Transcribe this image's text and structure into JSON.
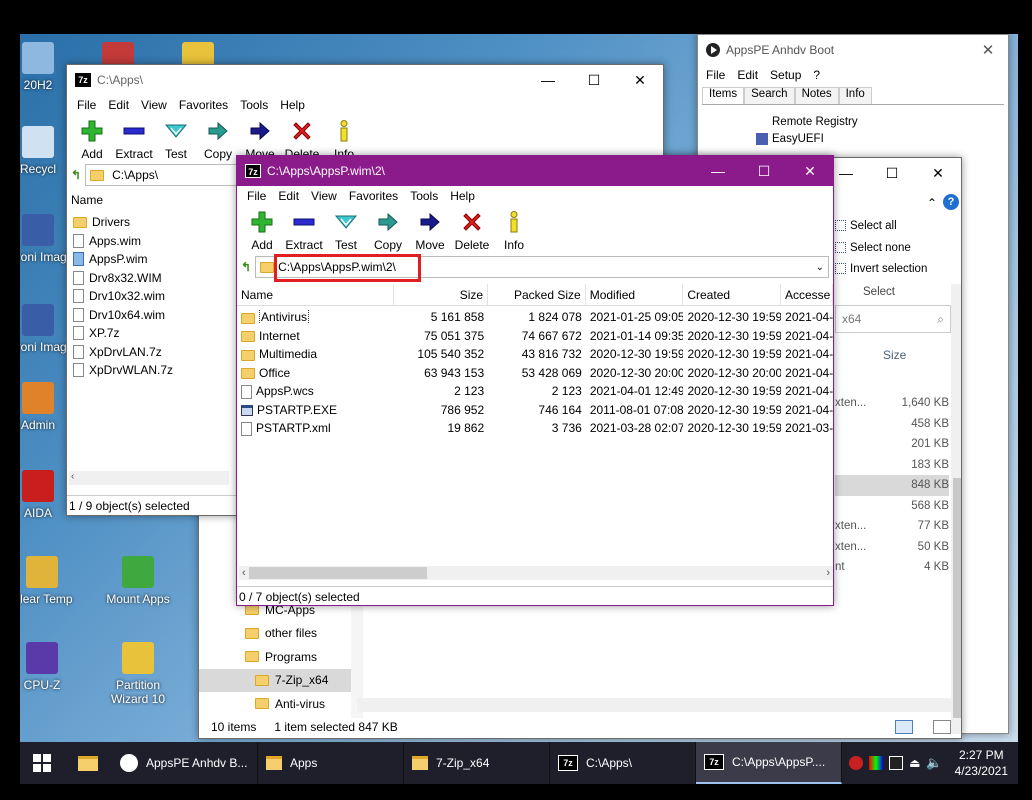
{
  "desktop": {
    "icons": [
      {
        "label": "20H2",
        "icon": "computer-icon",
        "color": "#8fb8e0"
      },
      {
        "label": "",
        "icon": "drive-icon",
        "color": "#c23a3a"
      },
      {
        "label": "",
        "icon": "wizard-icon",
        "color": "#e8c23a"
      },
      {
        "label": "Recycl",
        "icon": "recycle-bin-icon",
        "color": "#d0e2f2"
      },
      {
        "label": "Acroni Image",
        "icon": "acronis-icon",
        "color": "#3a5da8"
      },
      {
        "label": "Acroni Image",
        "icon": "acronis-icon",
        "color": "#3a5da8"
      },
      {
        "label": "Admin",
        "icon": "admin-icon",
        "color": "#e0822a"
      },
      {
        "label": "AIDA",
        "icon": "aida-icon",
        "color": "#c81e1e"
      },
      {
        "label": "Clear Temp",
        "icon": "broom-icon",
        "color": "#e0b43a"
      },
      {
        "label": "Mount Apps",
        "icon": "mount-icon",
        "color": "#3fa83f"
      },
      {
        "label": "CPU-Z",
        "icon": "cpuz-icon",
        "color": "#5a3aa8"
      },
      {
        "label": "Partition Wizard 10",
        "icon": "wizard-icon",
        "color": "#e8c23a"
      }
    ]
  },
  "back_window": {
    "title": "C:\\Apps\\",
    "menu": [
      "File",
      "Edit",
      "View",
      "Favorites",
      "Tools",
      "Help"
    ],
    "toolbar": [
      "Add",
      "Extract",
      "Test",
      "Copy",
      "Move",
      "Delete",
      "Info"
    ],
    "address": "C:\\Apps\\",
    "column_name": "Name",
    "files": [
      {
        "name": "Drivers",
        "type": "folder"
      },
      {
        "name": "Apps.wim",
        "type": "file"
      },
      {
        "name": "AppsP.wim",
        "type": "file-selected"
      },
      {
        "name": "Drv8x32.WIM",
        "type": "file"
      },
      {
        "name": "Drv10x32.wim",
        "type": "file"
      },
      {
        "name": "Drv10x64.wim",
        "type": "file"
      },
      {
        "name": "XP.7z",
        "type": "file"
      },
      {
        "name": "XpDrvLAN.7z",
        "type": "file"
      },
      {
        "name": "XpDrvWLAN.7z",
        "type": "file"
      }
    ],
    "status": "1 / 9 object(s) selected"
  },
  "appspe_window": {
    "title": "AppsPE Anhdv Boot",
    "menu": [
      "File",
      "Edit",
      "Setup",
      "?"
    ],
    "tabs": [
      "Items",
      "Search",
      "Notes",
      "Info"
    ],
    "items": [
      "Remote Registry",
      "EasyUEFI"
    ]
  },
  "explorer_window": {
    "ribbon": [
      "Select all",
      "Select none",
      "Invert selection"
    ],
    "ribbon_group": "Select",
    "search_text": "x64",
    "size_header": "Size",
    "sizes": [
      "1,640 KB",
      "458 KB",
      "201 KB",
      "183 KB",
      "848 KB",
      "568 KB",
      "77 KB",
      "50 KB",
      "4 KB"
    ],
    "partials": [
      "xten...",
      "",
      "",
      "",
      "",
      "",
      "xten...",
      "xten...",
      "nt"
    ],
    "nav": [
      "MC-Apps",
      "other files",
      "Programs",
      "7-Zip_x64",
      "Anti-virus"
    ],
    "status_count": "10 items",
    "status_selected": "1 item selected  847 KB"
  },
  "front_window": {
    "title": "C:\\Apps\\AppsP.wim\\2\\",
    "title_color": "#8b1a8b",
    "menu": [
      "File",
      "Edit",
      "View",
      "Favorites",
      "Tools",
      "Help"
    ],
    "toolbar": [
      "Add",
      "Extract",
      "Test",
      "Copy",
      "Move",
      "Delete",
      "Info"
    ],
    "address": "C:\\Apps\\AppsP.wim\\2\\",
    "highlight_color": "#e02020",
    "columns": [
      "Name",
      "Size",
      "Packed Size",
      "Modified",
      "Created",
      "Accesse"
    ],
    "rows": [
      {
        "name": "Antivirus",
        "type": "folder",
        "size": "5 161 858",
        "packed": "1 824 078",
        "modified": "2021-01-25 09:05",
        "created": "2020-12-30 19:59",
        "accessed": "2021-04-"
      },
      {
        "name": "Internet",
        "type": "folder",
        "size": "75 051 375",
        "packed": "74 667 672",
        "modified": "2021-01-14 09:35",
        "created": "2020-12-30 19:59",
        "accessed": "2021-04-"
      },
      {
        "name": "Multimedia",
        "type": "folder",
        "size": "105 540 352",
        "packed": "43 816 732",
        "modified": "2020-12-30 19:59",
        "created": "2020-12-30 19:59",
        "accessed": "2021-04-"
      },
      {
        "name": "Office",
        "type": "folder",
        "size": "63 943 153",
        "packed": "53 428 069",
        "modified": "2020-12-30 20:00",
        "created": "2020-12-30 20:00",
        "accessed": "2021-04-"
      },
      {
        "name": "AppsP.wcs",
        "type": "file",
        "size": "2 123",
        "packed": "2 123",
        "modified": "2021-04-01 12:49",
        "created": "2020-12-30 19:59",
        "accessed": "2021-04-"
      },
      {
        "name": "PSTARTP.EXE",
        "type": "exe",
        "size": "786 952",
        "packed": "746 164",
        "modified": "2011-08-01 07:08",
        "created": "2020-12-30 19:59",
        "accessed": "2021-04-"
      },
      {
        "name": "PSTARTP.xml",
        "type": "xml",
        "size": "19 862",
        "packed": "3 736",
        "modified": "2021-03-28 02:07",
        "created": "2020-12-30 19:59",
        "accessed": "2021-03-"
      }
    ],
    "status": "0 / 7 object(s) selected"
  },
  "taskbar": {
    "items": [
      {
        "label": "AppsPE Anhdv B...",
        "icon": "appspe-icon",
        "active": false
      },
      {
        "label": "Apps",
        "icon": "folder-icon",
        "active": false
      },
      {
        "label": "7-Zip_x64",
        "icon": "folder-icon",
        "active": false
      },
      {
        "label": "C:\\Apps\\",
        "icon": "7zip-icon",
        "active": false
      },
      {
        "label": "C:\\Apps\\AppsP....",
        "icon": "7zip-icon",
        "active": true
      }
    ],
    "time": "2:27 PM",
    "date": "4/23/2021"
  }
}
